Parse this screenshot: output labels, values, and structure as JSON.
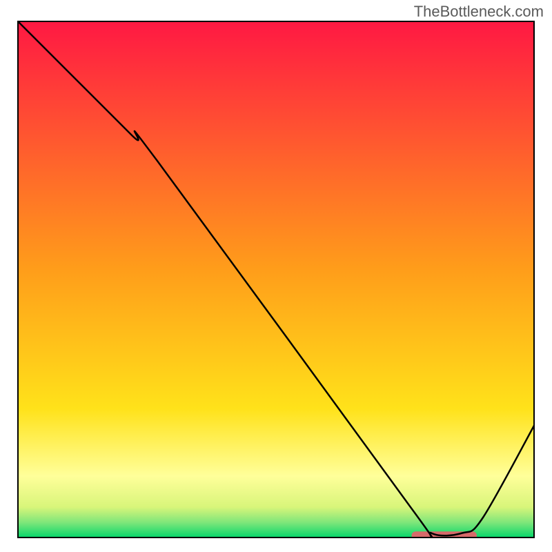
{
  "watermark": "TheBottleneck.com",
  "chart_data": {
    "type": "line",
    "title": "",
    "xlabel": "",
    "ylabel": "",
    "xlim": [
      0,
      100
    ],
    "ylim": [
      0,
      100
    ],
    "background_gradient": {
      "stops": [
        {
          "offset": 0,
          "color": "#ff1843"
        },
        {
          "offset": 48,
          "color": "#ff9d1a"
        },
        {
          "offset": 75,
          "color": "#ffe21a"
        },
        {
          "offset": 88,
          "color": "#ffff9a"
        },
        {
          "offset": 94,
          "color": "#d8f57a"
        },
        {
          "offset": 97,
          "color": "#7de67a"
        },
        {
          "offset": 100,
          "color": "#00d66a"
        }
      ]
    },
    "series": [
      {
        "name": "curve",
        "color": "#000000",
        "width": 2.5,
        "points": [
          {
            "x": 0,
            "y": 100
          },
          {
            "x": 22,
            "y": 78
          },
          {
            "x": 27,
            "y": 73
          },
          {
            "x": 76,
            "y": 6
          },
          {
            "x": 80,
            "y": 1
          },
          {
            "x": 86,
            "y": 1
          },
          {
            "x": 90,
            "y": 4
          },
          {
            "x": 100,
            "y": 22
          }
        ]
      }
    ],
    "marker_bar": {
      "x_start": 77,
      "x_end": 88,
      "y": 0.5,
      "color": "#d66a6a",
      "thickness": 12
    }
  }
}
